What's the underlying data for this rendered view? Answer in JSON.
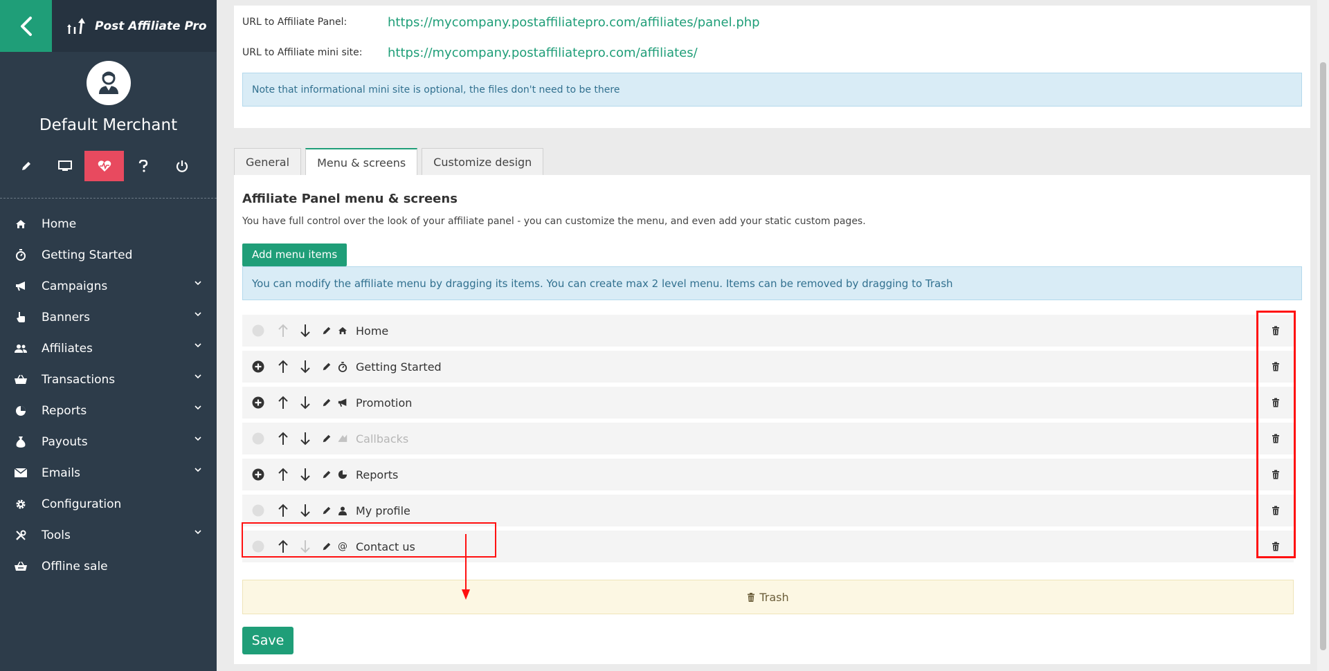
{
  "sidebar": {
    "brand_name": "Post Affiliate Pro",
    "merchant_name": "Default Merchant",
    "nav": [
      {
        "label": "Home",
        "icon": "home-icon",
        "has_submenu": false
      },
      {
        "label": "Getting Started",
        "icon": "stopwatch-icon",
        "has_submenu": false
      },
      {
        "label": "Campaigns",
        "icon": "megaphone-icon",
        "has_submenu": true
      },
      {
        "label": "Banners",
        "icon": "pointer-hand-icon",
        "has_submenu": true
      },
      {
        "label": "Affiliates",
        "icon": "users-icon",
        "has_submenu": true
      },
      {
        "label": "Transactions",
        "icon": "basket-icon",
        "has_submenu": true
      },
      {
        "label": "Reports",
        "icon": "pie-chart-icon",
        "has_submenu": true
      },
      {
        "label": "Payouts",
        "icon": "money-bag-icon",
        "has_submenu": true
      },
      {
        "label": "Emails",
        "icon": "envelope-icon",
        "has_submenu": true
      },
      {
        "label": "Configuration",
        "icon": "gear-icon",
        "has_submenu": false
      },
      {
        "label": "Tools",
        "icon": "tools-icon",
        "has_submenu": true
      },
      {
        "label": "Offline sale",
        "icon": "offline-basket-icon",
        "has_submenu": false
      }
    ]
  },
  "urls": {
    "panel_label": "URL to Affiliate Panel:",
    "panel_url": "https://mycompany.postaffiliatepro.com/affiliates/panel.php",
    "minisite_label": "URL to Affiliate mini site:",
    "minisite_url": "https://mycompany.postaffiliatepro.com/affiliates/",
    "note": "Note that informational mini site is optional, the files don't need to be there"
  },
  "tabs": [
    "General",
    "Menu & screens",
    "Customize design"
  ],
  "panel": {
    "title": "Affiliate Panel menu & screens",
    "description": "You have full control over the look of your affiliate panel - you can customize the menu, and even add your static custom pages.",
    "add_button": "Add menu items",
    "drag_info": "You can modify the affiliate menu by dragging its items. You can create max 2 level menu. Items can be removed by dragging to Trash",
    "items": [
      {
        "label": "Home",
        "icon": "home-icon",
        "has_submenu_toggle": false,
        "can_move_up": false,
        "can_move_down": true,
        "disabled": false
      },
      {
        "label": "Getting Started",
        "icon": "stopwatch-icon",
        "has_submenu_toggle": true,
        "can_move_up": true,
        "can_move_down": true,
        "disabled": false
      },
      {
        "label": "Promotion",
        "icon": "megaphone-icon",
        "has_submenu_toggle": true,
        "can_move_up": true,
        "can_move_down": true,
        "disabled": false
      },
      {
        "label": "Callbacks",
        "icon": "callbacks-icon",
        "has_submenu_toggle": false,
        "can_move_up": true,
        "can_move_down": true,
        "disabled": true
      },
      {
        "label": "Reports",
        "icon": "pie-chart-icon",
        "has_submenu_toggle": true,
        "can_move_up": true,
        "can_move_down": true,
        "disabled": false
      },
      {
        "label": "My profile",
        "icon": "user-icon",
        "has_submenu_toggle": false,
        "can_move_up": true,
        "can_move_down": true,
        "disabled": false
      },
      {
        "label": "Contact us",
        "icon": "at-sign-icon",
        "has_submenu_toggle": false,
        "can_move_up": true,
        "can_move_down": false,
        "disabled": false
      }
    ],
    "trash_label": "Trash",
    "save_button": "Save"
  },
  "colors": {
    "accent": "#1f9e78",
    "sidebar_bg": "#2d3c4a",
    "active_icon_bg": "#e84a5f",
    "annotation": "#ff1010"
  }
}
